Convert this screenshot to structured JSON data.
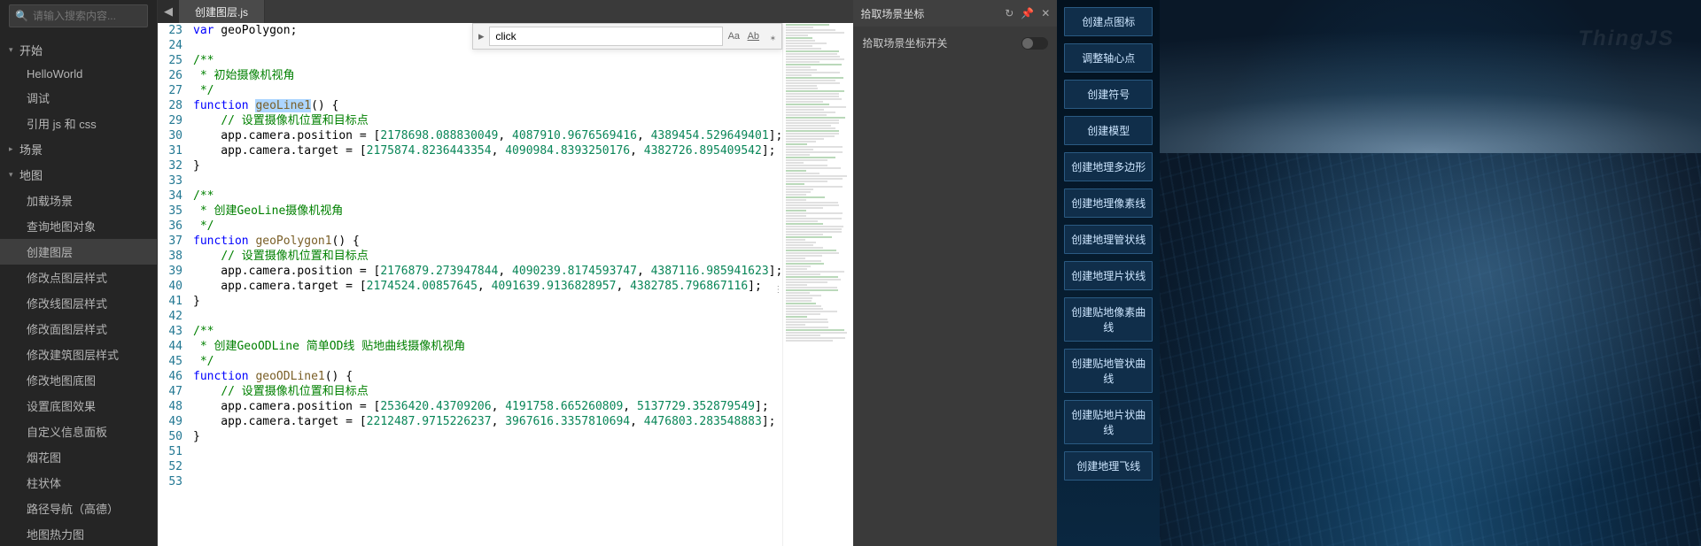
{
  "sidebar": {
    "search_placeholder": "请输入搜索内容...",
    "groups": [
      {
        "label": "开始",
        "open": true,
        "items": [
          "HelloWorld",
          "调试",
          "引用 js 和 css"
        ]
      },
      {
        "label": "场景",
        "open": false,
        "items": []
      },
      {
        "label": "地图",
        "open": true,
        "items": [
          "加载场景",
          "查询地图对象",
          "创建图层",
          "修改点图层样式",
          "修改线图层样式",
          "修改面图层样式",
          "修改建筑图层样式",
          "修改地图底图",
          "设置底图效果",
          "自定义信息面板",
          "烟花图",
          "柱状体",
          "路径导航（高德）",
          "地图热力图"
        ],
        "active": "创建图层"
      }
    ]
  },
  "editor": {
    "tab": "创建图层.js",
    "find_value": "click",
    "find_opts": [
      "Aa",
      "Ab",
      "⁎"
    ],
    "first_line": 23,
    "lines": [
      {
        "n": 23,
        "html": "<span class='kw'>var</span> geoPolygon;"
      },
      {
        "n": 24,
        "html": ""
      },
      {
        "n": 25,
        "html": "<span class='cmt'>/**</span>"
      },
      {
        "n": 26,
        "html": "<span class='cmt'> * 初始摄像机视角</span>"
      },
      {
        "n": 27,
        "html": "<span class='cmt'> */</span>"
      },
      {
        "n": 28,
        "html": "<span class='kw'>function</span> <span class='fn fnhl'>geoLine1</span>() {"
      },
      {
        "n": 29,
        "html": "    <span class='cmt'>// 设置摄像机位置和目标点</span>"
      },
      {
        "n": 30,
        "html": "    app.camera.position = [<span class='num'>2178698.088830049</span>, <span class='num'>4087910.9676569416</span>, <span class='num'>4389454.529649401</span>];"
      },
      {
        "n": 31,
        "html": "    app.camera.target = [<span class='num'>2175874.8236443354</span>, <span class='num'>4090984.8393250176</span>, <span class='num'>4382726.895409542</span>];"
      },
      {
        "n": 32,
        "html": "}"
      },
      {
        "n": 33,
        "html": ""
      },
      {
        "n": 34,
        "html": "<span class='cmt'>/**</span>"
      },
      {
        "n": 35,
        "html": "<span class='cmt'> * 创建GeoLine摄像机视角</span>"
      },
      {
        "n": 36,
        "html": "<span class='cmt'> */</span>"
      },
      {
        "n": 37,
        "html": "<span class='kw'>function</span> <span class='fn'>geoPolygon1</span>() {"
      },
      {
        "n": 38,
        "html": "    <span class='cmt'>// 设置摄像机位置和目标点</span>"
      },
      {
        "n": 39,
        "html": "    app.camera.position = [<span class='num'>2176879.273947844</span>, <span class='num'>4090239.8174593747</span>, <span class='num'>4387116.985941623</span>];"
      },
      {
        "n": 40,
        "html": "    app.camera.target = [<span class='num'>2174524.00857645</span>, <span class='num'>4091639.9136828957</span>, <span class='num'>4382785.796867116</span>];"
      },
      {
        "n": 41,
        "html": "}"
      },
      {
        "n": 42,
        "html": ""
      },
      {
        "n": 43,
        "html": "<span class='cmt'>/**</span>"
      },
      {
        "n": 44,
        "html": "<span class='cmt'> * 创建GeoODLine 简单OD线 贴地曲线摄像机视角</span>"
      },
      {
        "n": 45,
        "html": "<span class='cmt'> */</span>"
      },
      {
        "n": 46,
        "html": "<span class='kw'>function</span> <span class='fn'>geoODLine1</span>() {"
      },
      {
        "n": 47,
        "html": "    <span class='cmt'>// 设置摄像机位置和目标点</span>"
      },
      {
        "n": 48,
        "html": "    app.camera.position = [<span class='num'>2536420.43709206</span>, <span class='num'>4191758.665260809</span>, <span class='num'>5137729.352879549</span>];"
      },
      {
        "n": 49,
        "html": "    app.camera.target = [<span class='num'>2212487.9715226237</span>, <span class='num'>3967616.3357810694</span>, <span class='num'>4476803.283548883</span>];"
      },
      {
        "n": 50,
        "html": "}"
      }
    ],
    "line_numbers": [
      23,
      24,
      25,
      26,
      27,
      28,
      29,
      30,
      31,
      32,
      33,
      34,
      35,
      36,
      37,
      38,
      39,
      40,
      41,
      42,
      43,
      44,
      45,
      46,
      47,
      48,
      49,
      50,
      51,
      52,
      53
    ]
  },
  "panel": {
    "title": "拾取场景坐标",
    "switch_label": "拾取场景坐标开关"
  },
  "scene_buttons": [
    "创建点图标",
    "调整轴心点",
    "创建符号",
    "创建模型",
    "创建地理多边形",
    "创建地理像素线",
    "创建地理管状线",
    "创建地理片状线",
    "创建贴地像素曲线",
    "创建贴地管状曲线",
    "创建贴地片状曲线",
    "创建地理飞线"
  ],
  "watermark": "ThingJS"
}
